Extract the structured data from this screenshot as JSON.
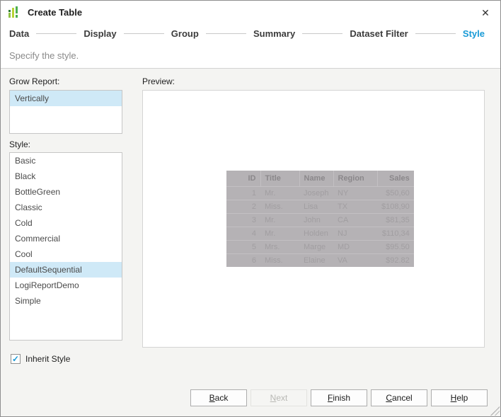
{
  "window": {
    "title": "Create Table",
    "close_glyph": "✕"
  },
  "steps": {
    "items": [
      "Data",
      "Display",
      "Group",
      "Summary",
      "Dataset Filter",
      "Style"
    ],
    "active": "Style"
  },
  "description": "Specify the style.",
  "grow_report": {
    "label": "Grow Report:",
    "items": [
      "Vertically"
    ],
    "selected": "Vertically"
  },
  "style_list": {
    "label": "Style:",
    "items": [
      "Basic",
      "Black",
      "BottleGreen",
      "Classic",
      "Cold",
      "Commercial",
      "Cool",
      "DefaultSequential",
      "LogiReportDemo",
      "Simple"
    ],
    "selected": "DefaultSequential"
  },
  "preview": {
    "label": "Preview:",
    "table": {
      "columns": [
        "ID",
        "Title",
        "Name",
        "Region",
        "Sales"
      ],
      "rows": [
        [
          "1",
          "Mr.",
          "Joseph",
          "NY",
          "$50,60"
        ],
        [
          "2",
          "Miss.",
          "Lisa",
          "TX",
          "$108,90"
        ],
        [
          "3",
          "Mr.",
          "John",
          "CA",
          "$81,35"
        ],
        [
          "4",
          "Mr.",
          "Holden",
          "NJ",
          "$110,34"
        ],
        [
          "5",
          "Mrs.",
          "Marge",
          "MD",
          "$95.50"
        ],
        [
          "6",
          "Miss.",
          "Elaine",
          "VA",
          "$92.82"
        ]
      ]
    }
  },
  "inherit_style": {
    "label": "Inherit Style",
    "checked": true,
    "check_glyph": "✓"
  },
  "buttons": {
    "items": [
      {
        "ak": "B",
        "rest": "ack",
        "disabled": false
      },
      {
        "ak": "N",
        "rest": "ext",
        "disabled": true
      },
      {
        "ak": "F",
        "rest": "inish",
        "disabled": false
      },
      {
        "ak": "C",
        "rest": "ancel",
        "disabled": false
      },
      {
        "ak": "H",
        "rest": "elp",
        "disabled": false
      }
    ]
  },
  "colors": {
    "accent_blue": "#189ad6",
    "selection_bg": "#cfe9f7",
    "body_bg": "#f4f4f2",
    "preview_table_bg": "#b5b2b5",
    "icon_green_light": "#b5d334",
    "icon_green_dark": "#4caf50"
  }
}
